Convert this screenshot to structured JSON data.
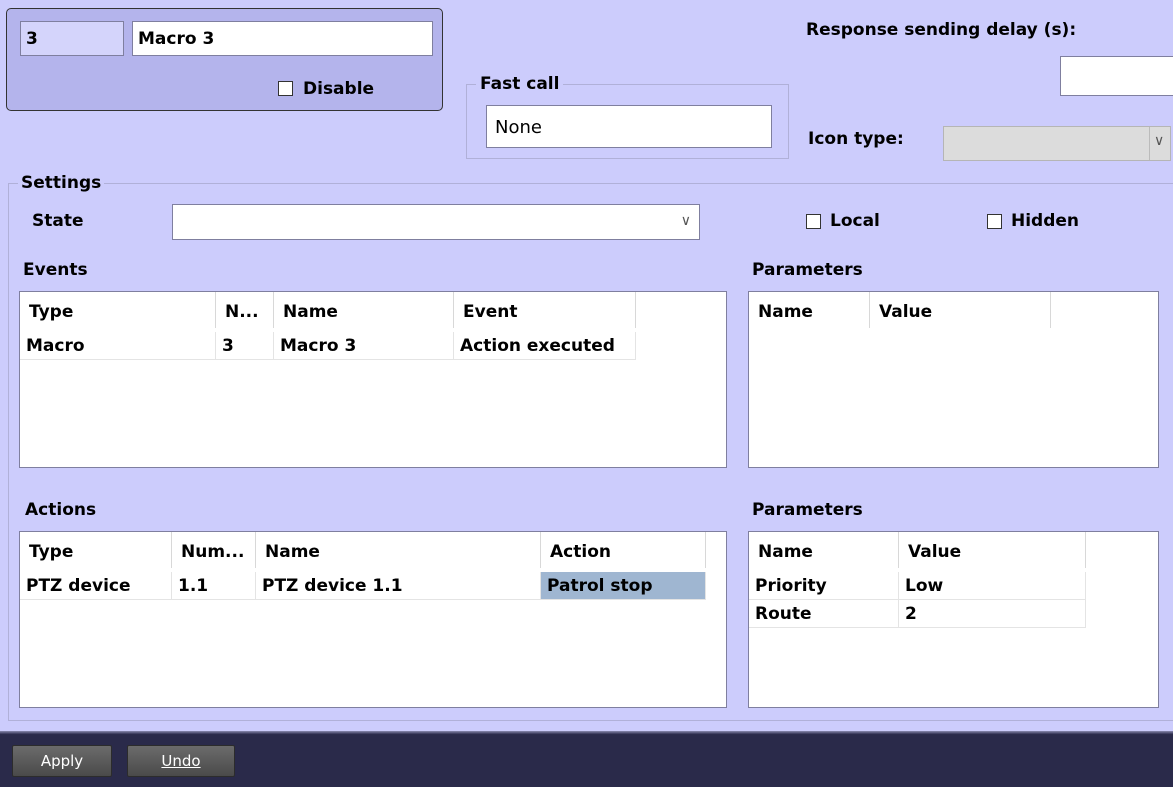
{
  "header": {
    "id_value": "3",
    "name_value": "Macro 3",
    "disable_label": "Disable",
    "fast_call_label": "Fast call",
    "fast_call_value": "None",
    "response_delay_label": "Response sending delay (s):",
    "response_delay_value": "",
    "icon_type_label": "Icon type:",
    "icon_type_value": ""
  },
  "settings": {
    "title": "Settings",
    "state_label": "State",
    "state_value": "",
    "local_label": "Local",
    "hidden_label": "Hidden"
  },
  "events": {
    "title": "Events",
    "columns": [
      "Type",
      "N...",
      "Name",
      "Event"
    ],
    "rows": [
      [
        "Macro",
        "3",
        "Macro 3",
        "Action executed"
      ]
    ]
  },
  "events_params": {
    "title": "Parameters",
    "columns": [
      "Name",
      "Value"
    ],
    "rows": []
  },
  "actions": {
    "title": "Actions",
    "columns": [
      "Type",
      "Num...",
      "Name",
      "Action"
    ],
    "rows": [
      [
        "PTZ device",
        "1.1",
        "PTZ device 1.1",
        "Patrol stop"
      ]
    ]
  },
  "actions_params": {
    "title": "Parameters",
    "columns": [
      "Name",
      "Value"
    ],
    "rows": [
      [
        "Priority",
        "Low"
      ],
      [
        "Route",
        "2"
      ]
    ]
  },
  "footer": {
    "apply_label": "Apply",
    "undo_label": "Undo"
  },
  "colors": {
    "background": "#ccccfc",
    "selection": "#9fb6d1",
    "footer_bar": "#2a2a4a"
  }
}
